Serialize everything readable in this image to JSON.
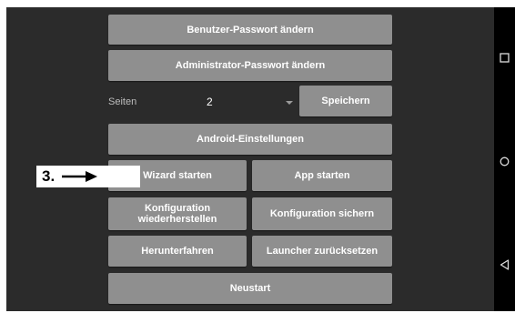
{
  "buttons": {
    "user_password": "Benutzer-Passwort ändern",
    "admin_password": "Administrator-Passwort ändern",
    "save": "Speichern",
    "android_settings": "Android-Einstellungen",
    "wizard_start": "Wizard starten",
    "app_start": "App starten",
    "config_restore_line1": "Konfiguration",
    "config_restore_line2": "wiederherstellen",
    "config_backup": "Konfiguration sichern",
    "shutdown": "Herunterfahren",
    "launcher_reset": "Launcher zurücksetzen",
    "restart": "Neustart"
  },
  "pages": {
    "label": "Seiten",
    "value": "2"
  },
  "annotation": {
    "label": "3."
  },
  "navbar": {
    "icons": [
      "recents-square-icon",
      "home-circle-icon",
      "back-triangle-icon"
    ]
  },
  "colors": {
    "screen_bg": "#2b2b2b",
    "button_bg": "#8f8f8f",
    "navbar_bg": "#000000"
  }
}
